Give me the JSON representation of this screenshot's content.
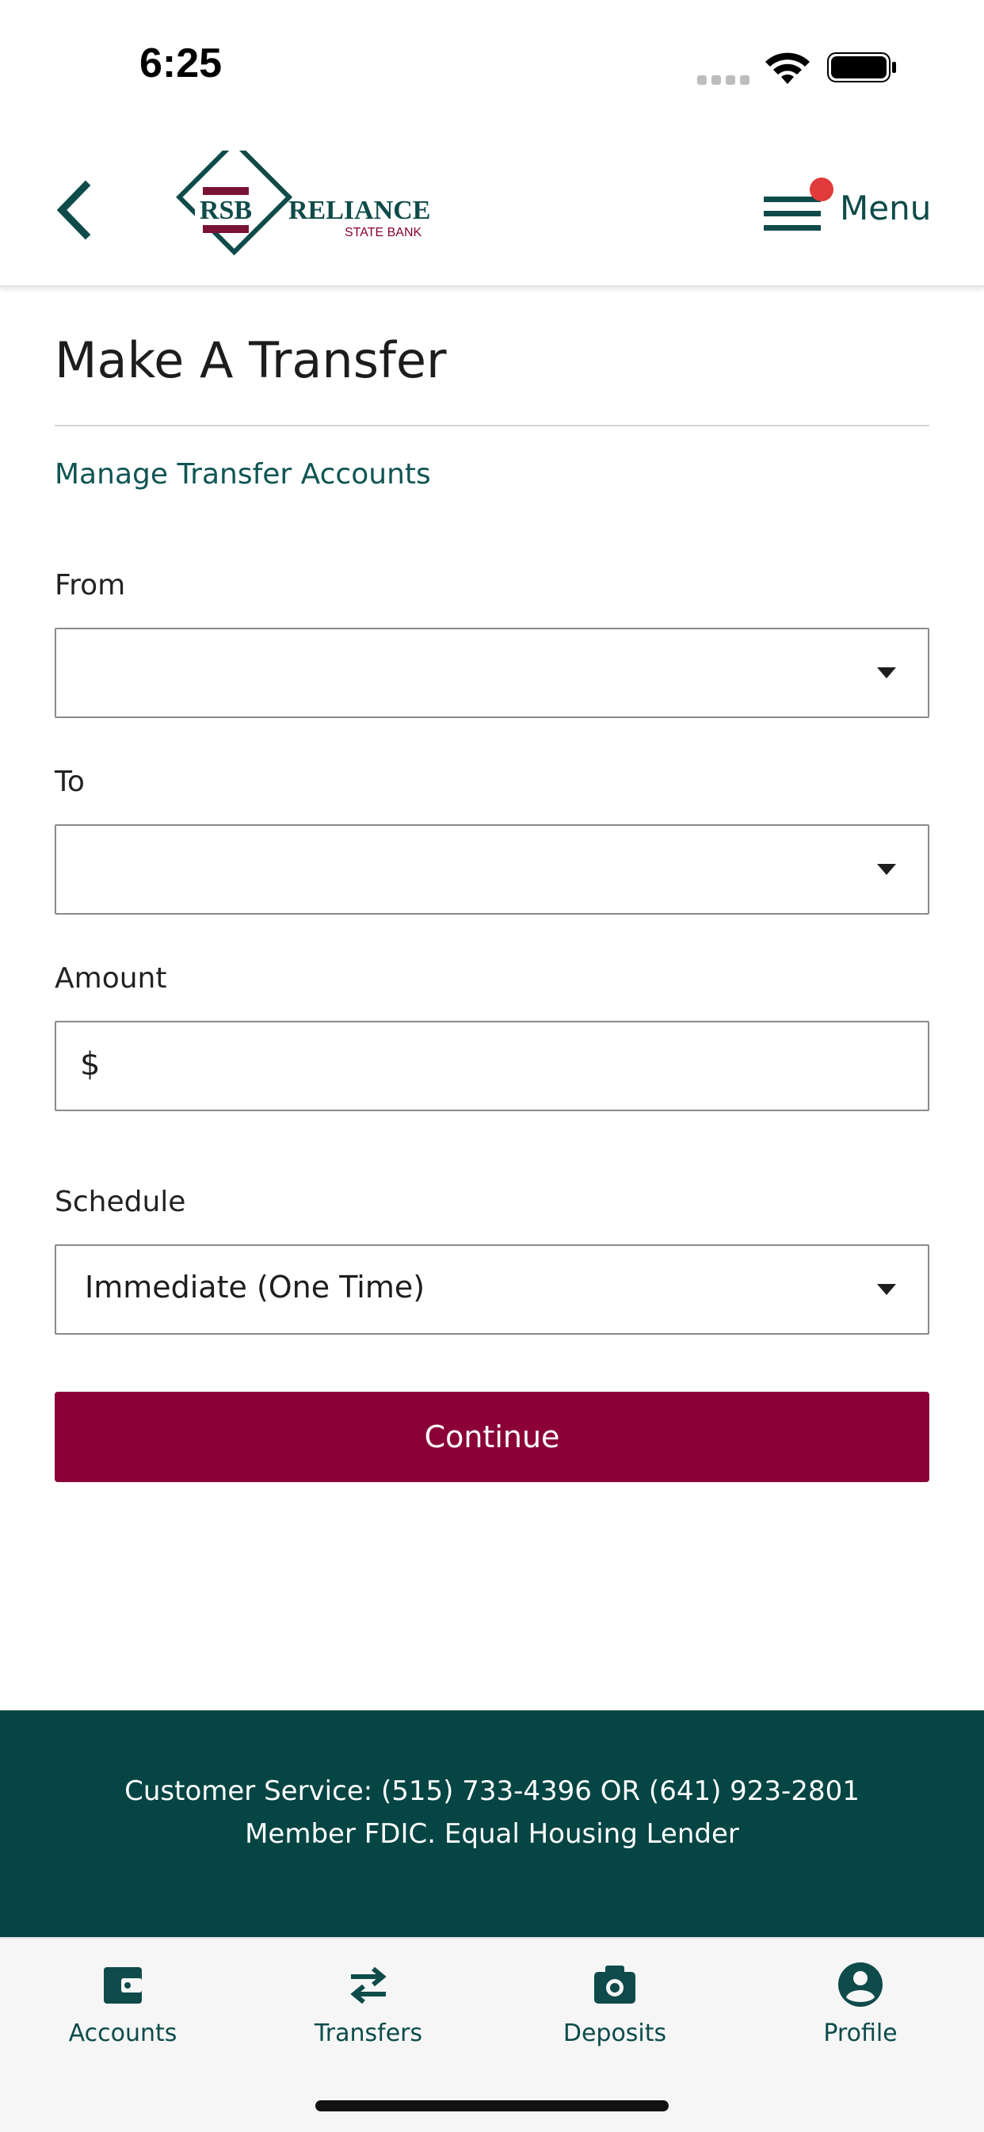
{
  "status_bar": {
    "time": "6:25"
  },
  "header": {
    "logo": {
      "monogram": "RSB",
      "name": "RELIANCE",
      "subname": "STATE BANK"
    },
    "menu_label": "Menu"
  },
  "page": {
    "title": "Make A Transfer",
    "manage_link": "Manage Transfer Accounts"
  },
  "form": {
    "from": {
      "label": "From",
      "value": ""
    },
    "to": {
      "label": "To",
      "value": ""
    },
    "amount": {
      "label": "Amount",
      "prefix": "$",
      "value": ""
    },
    "schedule": {
      "label": "Schedule",
      "value": "Immediate (One Time)"
    },
    "continue_label": "Continue"
  },
  "footer": {
    "line1": "Customer Service: (515) 733-4396 OR (641) 923-2801",
    "line2": "Member FDIC. Equal Housing Lender"
  },
  "tabs": [
    {
      "label": "Accounts",
      "icon": "wallet-icon"
    },
    {
      "label": "Transfers",
      "icon": "transfer-arrows-icon"
    },
    {
      "label": "Deposits",
      "icon": "camera-icon"
    },
    {
      "label": "Profile",
      "icon": "profile-icon"
    }
  ],
  "colors": {
    "brand_teal": "#0e4b4a",
    "brand_maroon": "#8a0037",
    "footer_bg": "#054544",
    "notification_dot": "#e03a3a"
  }
}
